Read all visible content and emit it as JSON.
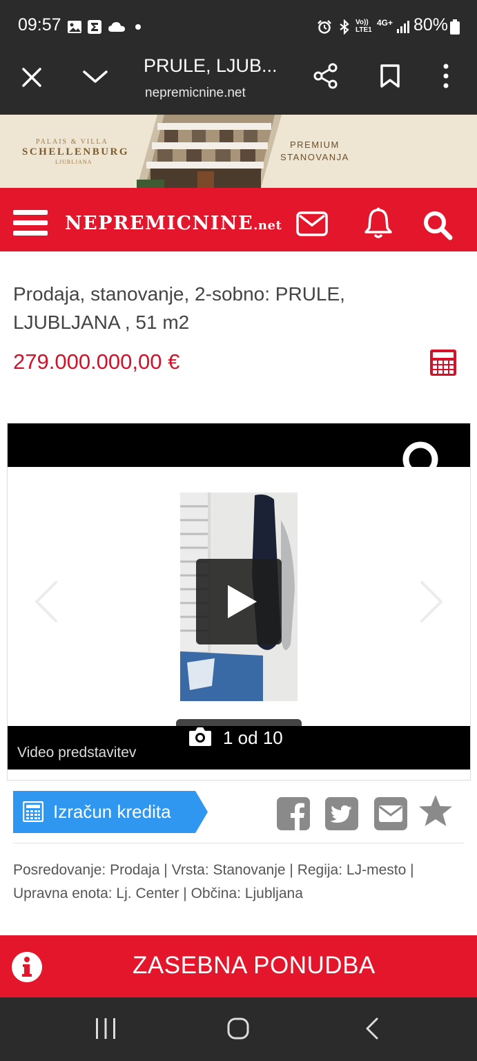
{
  "status_bar": {
    "time": "09:57",
    "left_icons": [
      "gallery-icon",
      "sigma-icon",
      "cloud-icon",
      "dot-icon"
    ],
    "right_icons": [
      "alarm-icon",
      "bluetooth-icon",
      "volte-icon",
      "4g-icon",
      "signal-icon"
    ],
    "volte_label": "Vo)) LTE1",
    "network_label": "4G+",
    "battery": "80%"
  },
  "browser": {
    "title": "PRULE, LJUB...",
    "url": "nepremicnine.net",
    "icons": [
      "close-icon",
      "chevron-down-icon",
      "share-icon",
      "bookmark-icon",
      "more-icon"
    ]
  },
  "ad": {
    "brand_top": "PALAIS & VILLA",
    "brand_main": "SCHELLENBURG",
    "brand_sub": "LJUBLJANA",
    "premium": "PREMIUM",
    "stanovanja": "STANOVANJA"
  },
  "site": {
    "logo_main": "NEPREMICNINE",
    "logo_net": ".net",
    "icons": [
      "menu-icon",
      "mail-icon",
      "bell-icon",
      "search-icon"
    ],
    "accent": "#e3162b"
  },
  "listing": {
    "title": "Prodaja, stanovanje, 2-sobno: PRULE, LJUBLJANA , 51 m2",
    "price": "279.000.000,00 €",
    "price_color": "#d3122a"
  },
  "gallery": {
    "counter": "1 od 10",
    "video_label": "Video predstavitev"
  },
  "actions": {
    "kredit_label": "Izračun kredita",
    "kredit_color": "#2f97f0",
    "share_icons": [
      "facebook-icon",
      "twitter-icon",
      "email-icon",
      "star-icon"
    ]
  },
  "meta": "Posredovanje: Prodaja | Vrsta: Stanovanje | Regija: LJ-mesto | Upravna enota: Lj. Center | Občina: Ljubljana",
  "private_offer": {
    "label": "ZASEBNA PONUDBA"
  },
  "nav": {
    "icons": [
      "recent-apps-icon",
      "home-icon",
      "back-icon"
    ]
  }
}
